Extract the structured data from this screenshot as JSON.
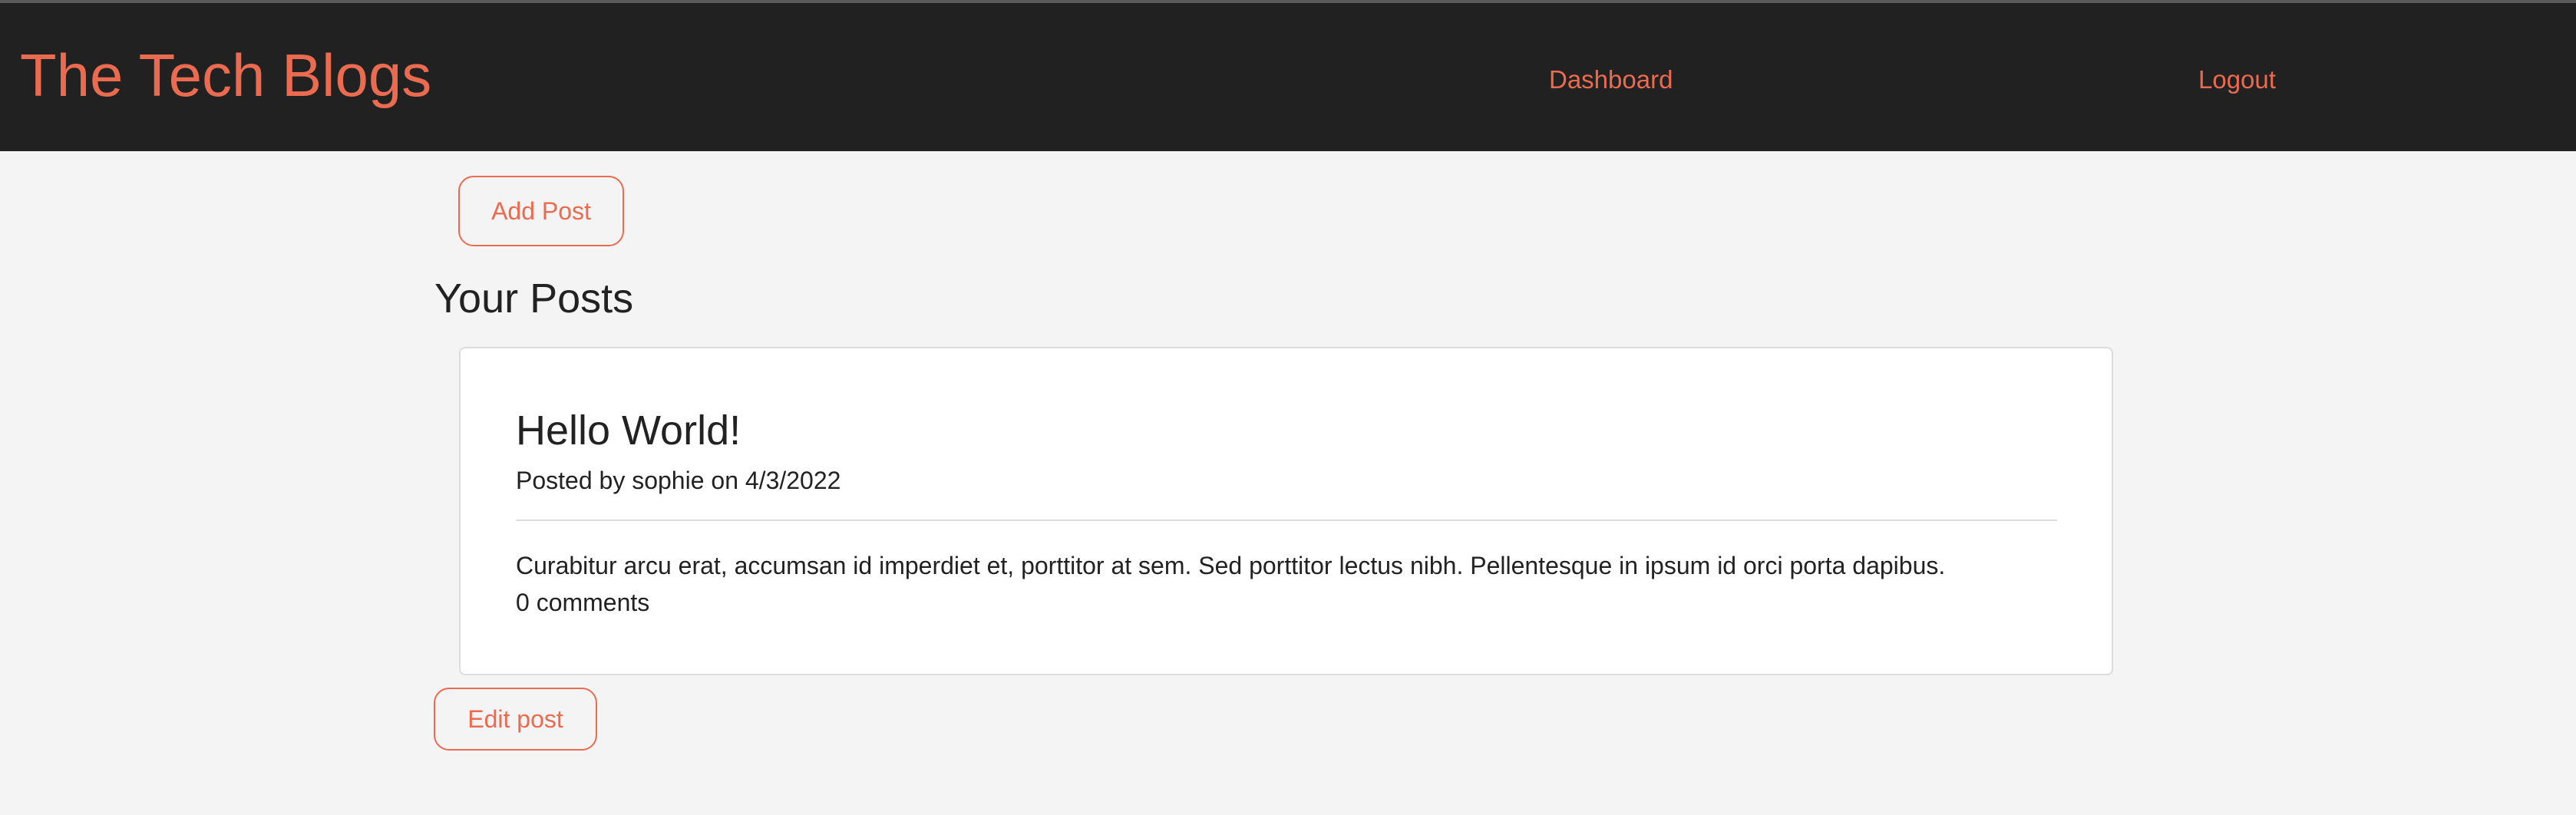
{
  "header": {
    "brand": "The Tech Blogs",
    "nav": {
      "dashboard": "Dashboard",
      "logout": "Logout"
    }
  },
  "actions": {
    "add_post": "Add Post",
    "edit_post": "Edit post"
  },
  "section": {
    "title": "Your Posts"
  },
  "post": {
    "title": "Hello World!",
    "meta": "Posted by sophie on 4/3/2022",
    "body": "Curabitur arcu erat, accumsan id imperdiet et, porttitor at sem. Sed porttitor lectus nibh. Pellentesque in ipsum id orci porta dapibus.",
    "comments": "0 comments"
  },
  "colors": {
    "accent": "#ea6b50",
    "header_bg": "#212121",
    "page_bg": "#f4f4f4",
    "card_bg": "#ffffff",
    "text": "#222222"
  }
}
